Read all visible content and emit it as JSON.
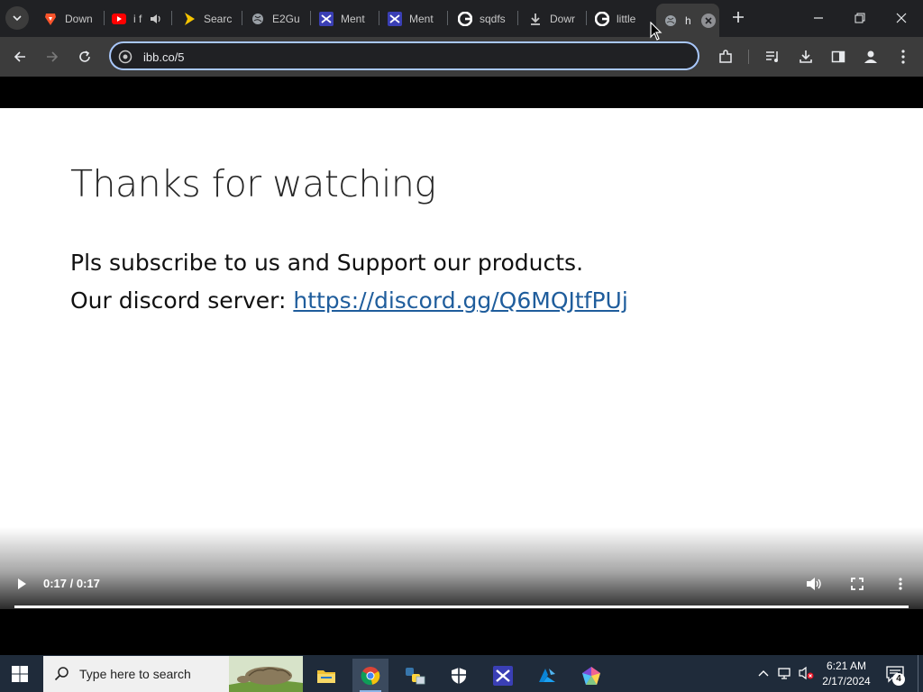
{
  "browser": {
    "tabs": [
      {
        "label": "Down",
        "icon": "brave-icon"
      },
      {
        "label": "i f",
        "icon": "youtube-icon",
        "audio": true
      },
      {
        "label": "Searc",
        "icon": "yellow-play-icon"
      },
      {
        "label": "E2Gu",
        "icon": "globe-icon"
      },
      {
        "label": "Ment",
        "icon": "mentor-icon"
      },
      {
        "label": "Ment",
        "icon": "mentor-icon"
      },
      {
        "label": "sqdfs",
        "icon": "google-icon"
      },
      {
        "label": "Dowr",
        "icon": "download-icon"
      },
      {
        "label": "little",
        "icon": "google-icon"
      },
      {
        "label": "h",
        "icon": "globe-icon",
        "active": true
      }
    ],
    "address": {
      "value": "ibb.co/5"
    }
  },
  "slide": {
    "title": "Thanks for watching",
    "line1": "Pls subscribe to us and Support our products.",
    "line2_prefix": "Our discord server: ",
    "link": "https://discord.gg/Q6MQJtfPUj"
  },
  "video": {
    "time": "0:17 / 0:17",
    "progress": 1.0
  },
  "taskbar": {
    "search_placeholder": "Type here to search",
    "apps": [
      "file-explorer-icon",
      "chrome-icon",
      "python-icon",
      "security-shield-icon",
      "mentor-app-icon",
      "azure-icon",
      "gem-app-icon"
    ],
    "time": "6:21 AM",
    "date": "2/17/2024",
    "notification_count": "4"
  },
  "colors": {
    "tabstrip": "#202124",
    "toolbar": "#3c3c3c",
    "omnibox_border": "#a8c7fa",
    "link": "#1f5d9c",
    "taskbar": "#1f2b3a"
  }
}
